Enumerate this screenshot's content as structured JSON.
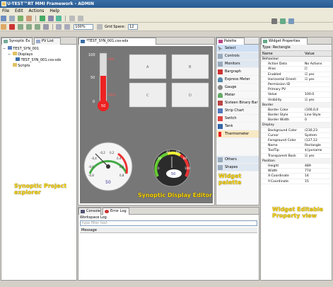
{
  "window": {
    "title": "U-TEST™RT MMI Framework - ADMIN"
  },
  "menu": [
    "File",
    "Edit",
    "Actions",
    "Help"
  ],
  "toolbar": {
    "zoom_value": "100%",
    "grid_label": "Grid Space:",
    "grid_value": "12"
  },
  "explorer": {
    "tabs": [
      "Synoptic Ex",
      "PV List"
    ],
    "tree": {
      "root": "TEST_SYN_001",
      "displays": "Displays",
      "file": "TEST_SYN_001.css-sds",
      "scripts": "Scripts"
    },
    "annotation": "Synoptic Project explorer"
  },
  "editor": {
    "tab": "*TEST_SYN_001.css-sds",
    "thermometer": {
      "labels": [
        "100",
        "50",
        "0"
      ],
      "marker_hi": "HIHI",
      "marker_lo": "LOLO",
      "value": 50
    },
    "rect_labels": [
      "A",
      "B",
      "C",
      "D"
    ],
    "meter": {
      "ticks": [
        "0,2",
        "0,4",
        "0,6",
        "0,8",
        "-0,2",
        "-0,4",
        "-0,6",
        "-0,8"
      ],
      "value": "50"
    },
    "gauge": {
      "ticks": [
        "40",
        "60",
        "80",
        "20",
        "100",
        "0"
      ],
      "value": "50"
    },
    "annotation": "Synoptic Display Editor"
  },
  "palette": {
    "title": "Palette",
    "select": "Select",
    "drawers": [
      "Controls",
      "Monitors"
    ],
    "items": [
      "Bargraph",
      "Express Meter",
      "Gauge",
      "Meter",
      "Sixteen Binary Bar",
      "Strip Chart",
      "Switch",
      "Tank",
      "Thermometer"
    ],
    "footer_drawers": [
      "Others",
      "Shapes"
    ],
    "annotation": "Widget palette"
  },
  "properties": {
    "tab": "Widget Properties",
    "type": "Type: Rectangle",
    "columns": [
      "Name",
      "Value"
    ],
    "rows": [
      {
        "name": "Behaviour",
        "value": "",
        "kind": "cat"
      },
      {
        "name": "Action Data",
        "value": "No Actions",
        "kind": "sub"
      },
      {
        "name": "Alias",
        "value": "[]",
        "kind": "sub"
      },
      {
        "name": "Enabled",
        "value": "☑ yes",
        "kind": "sub"
      },
      {
        "name": "Horizontal Orient:",
        "value": "☑ yes",
        "kind": "sub"
      },
      {
        "name": "Permission ID",
        "value": "",
        "kind": "sub"
      },
      {
        "name": "Primary PV",
        "value": "",
        "kind": "sub"
      },
      {
        "name": "Value",
        "value": "100.0",
        "kind": "sub"
      },
      {
        "name": "Visibility",
        "value": "☑ yes",
        "kind": "sub"
      },
      {
        "name": "Border",
        "value": "",
        "kind": "cat"
      },
      {
        "name": "Border Color",
        "value": "(100,0,0",
        "kind": "sub"
      },
      {
        "name": "Border Style",
        "value": "Line Style",
        "kind": "sub"
      },
      {
        "name": "Border Width",
        "value": "0",
        "kind": "sub"
      },
      {
        "name": "Display",
        "value": "",
        "kind": "cat"
      },
      {
        "name": "Background Color",
        "value": "(230,23",
        "kind": "sub"
      },
      {
        "name": "Cursor",
        "value": "System.",
        "kind": "sub"
      },
      {
        "name": "Foreground Color",
        "value": "(127,12",
        "kind": "sub"
      },
      {
        "name": "Name",
        "value": "Rectangle",
        "kind": "sub"
      },
      {
        "name": "ToolTip",
        "value": "${pvname}",
        "kind": "sub"
      },
      {
        "name": "Transparent Back",
        "value": "☑ yes",
        "kind": "sub"
      },
      {
        "name": "Position",
        "value": "",
        "kind": "cat"
      },
      {
        "name": "Height",
        "value": "489",
        "kind": "sub"
      },
      {
        "name": "Width",
        "value": "774",
        "kind": "sub"
      },
      {
        "name": "X-Coordinate",
        "value": "14",
        "kind": "sub"
      },
      {
        "name": "Y-Coordinate",
        "value": "15",
        "kind": "sub"
      }
    ],
    "annotation": "Widget Editable Property view"
  },
  "console": {
    "tabs": [
      "Console",
      "Error Log"
    ],
    "header": "Workspace Log",
    "filter_placeholder": "type filter text",
    "column": "Message"
  },
  "colors": {
    "accent": "#3a6ea5",
    "annotation": "#ffd700",
    "canvas": "#777777"
  }
}
